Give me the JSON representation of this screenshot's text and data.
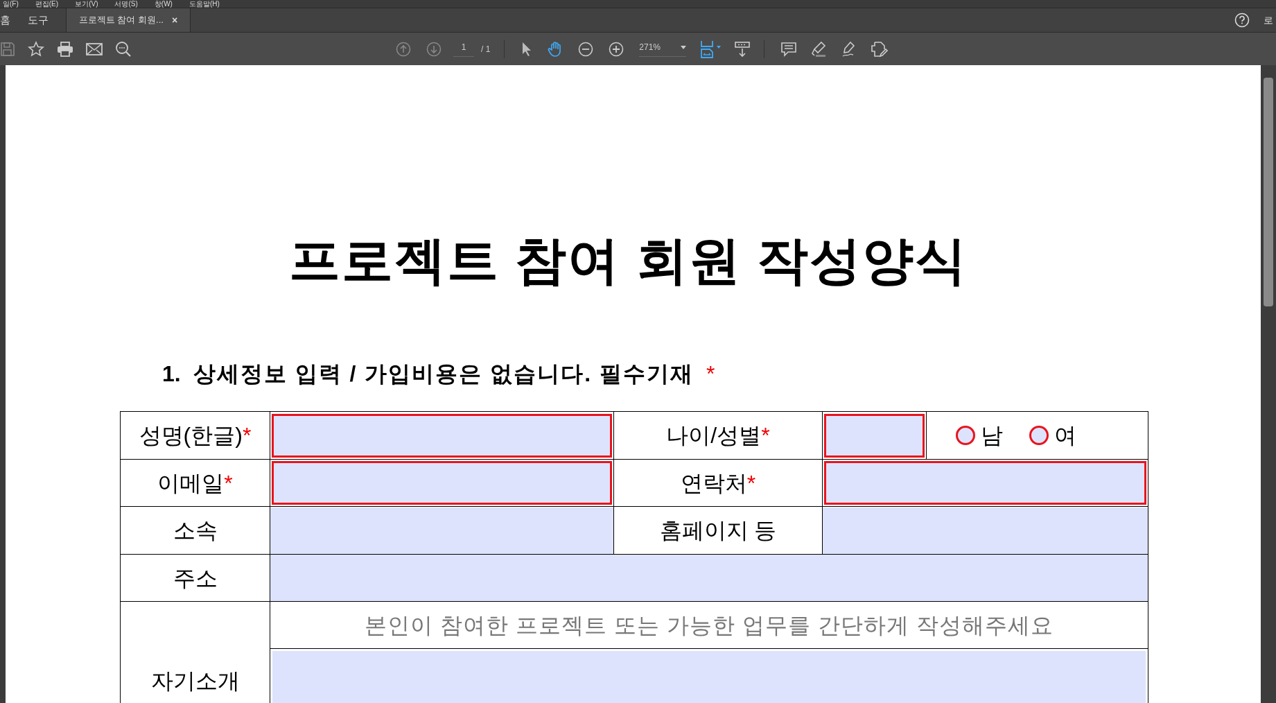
{
  "menu": [
    "일(F)",
    "편집(E)",
    "보기(V)",
    "서명(S)",
    "창(W)",
    "도움말(H)"
  ],
  "tabs": [
    {
      "label": "홈",
      "selected": false,
      "kind": "nav"
    },
    {
      "label": "도구",
      "selected": false,
      "kind": "nav"
    },
    {
      "label": "프로젝트 참여 회원...",
      "selected": true,
      "kind": "document",
      "close": "×"
    }
  ],
  "account": "로",
  "toolbar": {
    "page": "1",
    "page_total": "/ 1",
    "zoom": "271%"
  },
  "document": {
    "title": "프로젝트 참여 회원 작성양식",
    "section": {
      "number": "1.",
      "text": "상세정보 입력 / 가입비용은 없습니다. 필수기재",
      "mark": "*"
    },
    "form": [
      [
        {
          "kind": "label",
          "text": "성명(한글)",
          "mark": "*"
        },
        {
          "kind": "field",
          "required": true
        },
        {
          "kind": "label",
          "text": "나이/성별",
          "mark": "*"
        },
        {
          "kind": "field",
          "required": true
        },
        {
          "kind": "radios",
          "options": [
            {
              "label": "남",
              "selected": false
            },
            {
              "label": "여",
              "selected": false
            }
          ]
        }
      ],
      [
        {
          "kind": "label",
          "text": "이메일",
          "mark": "*"
        },
        {
          "kind": "field",
          "required": true
        },
        {
          "kind": "label",
          "text": "연락처",
          "mark": "*"
        },
        {
          "kind": "field",
          "required": true
        }
      ],
      [
        {
          "kind": "label",
          "text": "소속"
        },
        {
          "kind": "field",
          "required": false
        },
        {
          "kind": "label",
          "text": "홈페이지 등"
        },
        {
          "kind": "field",
          "required": false
        }
      ],
      [
        {
          "kind": "label",
          "text": "주소"
        },
        {
          "kind": "field",
          "required": false
        }
      ]
    ],
    "intro": {
      "label": "자기소개",
      "hint": "본인이 참여한 프로젝트 또는 가능한 업무를 간단하게 작성해주세요"
    }
  }
}
